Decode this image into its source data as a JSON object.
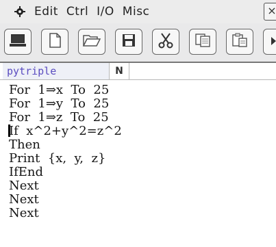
{
  "menubar": {
    "gear_icon": "gear-icon",
    "items": [
      {
        "label": "Edit"
      },
      {
        "label": "Ctrl"
      },
      {
        "label": "I/O"
      },
      {
        "label": "Misc"
      }
    ],
    "close_label": "×"
  },
  "toolbar": {
    "buttons": [
      {
        "icon": "computer-icon"
      },
      {
        "icon": "new-file-icon"
      },
      {
        "icon": "open-folder-icon"
      },
      {
        "icon": "save-icon"
      },
      {
        "icon": "cut-icon"
      },
      {
        "icon": "copy-icon"
      },
      {
        "icon": "paste-icon"
      }
    ]
  },
  "tab": {
    "program_name": "pytriple",
    "mode": "N"
  },
  "editor": {
    "lines": [
      "For  1⇒x  To  25",
      "For  1⇒y  To  25",
      "For  1⇒z  To  25",
      "If  x^2+y^2=z^2",
      "Then",
      "Print  {x,  y,  z}",
      "IfEnd",
      "Next",
      "Next",
      "Next"
    ]
  }
}
